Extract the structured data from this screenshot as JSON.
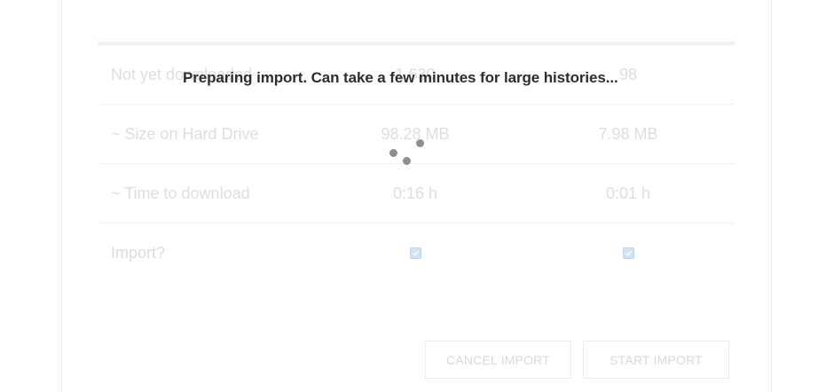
{
  "overlay": {
    "message": "Preparing import. Can take a few minutes for large histories..."
  },
  "table": {
    "rows": [
      {
        "label": "Not yet downloaded",
        "value1": "1,630",
        "value2": "98"
      },
      {
        "label": "~ Size on Hard Drive",
        "value1": "98.28 MB",
        "value2": "7.98 MB"
      },
      {
        "label": "~ Time to download",
        "value1": "0:16 h",
        "value2": "0:01 h"
      }
    ],
    "import_label": "Import?",
    "import_checked": [
      true,
      true
    ]
  },
  "buttons": {
    "cancel_label": "CANCEL IMPORT",
    "start_label": "START IMPORT"
  },
  "colors": {
    "spinner": "#8e8e8e",
    "checkbox": "#cfe3f6",
    "faded_text": "#dedede",
    "message_text": "#2d2d2d"
  },
  "icons": {
    "spinner": "loading-spinner-icon",
    "checkbox": "checkbox-checked-icon"
  }
}
